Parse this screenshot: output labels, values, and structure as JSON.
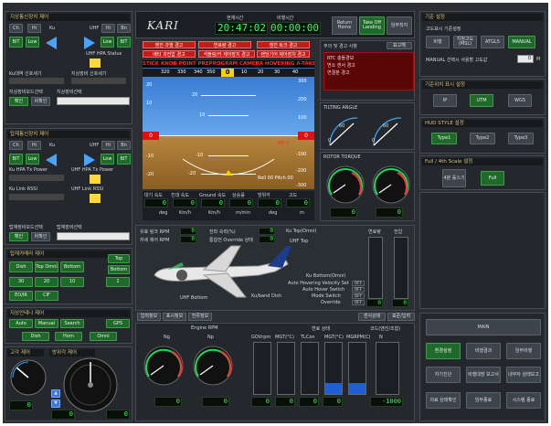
{
  "left": {
    "sec1": {
      "title": "지상통신장치 제어",
      "row1": [
        "Ch",
        "Hi",
        "Ku",
        "UHF",
        "Hi",
        "Bn"
      ],
      "row2a": "BIT",
      "row2b": "Low",
      "row2c": "Low",
      "row2d": "BIT",
      "status": "UHF HPA Status",
      "lbl1": "Ku대역 신호세기",
      "lbl2": "지상장비 신호세기",
      "lbl3": "지상장비모드선택",
      "lbl4": "지상장비선택",
      "btn_a": "확인",
      "btn_b": "비확인"
    },
    "sec2": {
      "title": "탑재통신장치 제어",
      "row1": [
        "Ch",
        "Hi",
        "Ku",
        "UHF",
        "Hi",
        "Bn"
      ],
      "row2a": "BIT",
      "row2b": "Low",
      "row2c": "Low",
      "row2d": "BIT",
      "l1": "Ku HPA Tx Power",
      "l2": "UHF HPA Tx Power",
      "l3": "Ku Link RSSI",
      "l4": "UHF Link RSSI",
      "l5": "탑재장비모드선택",
      "l6": "탑재장비선택",
      "btn_a": "확인",
      "btn_b": "비확인"
    },
    "sec3": {
      "title": "탑재카메라 제어",
      "b1": "Dish",
      "b2": "Top Omni",
      "b3": "Bottom",
      "b4": "Top",
      "b5": "Bottom",
      "n1": "30",
      "n2": "20",
      "n3": "10",
      "n4": "1",
      "b6": "EO/IR",
      "b7": "CIF"
    },
    "sec4": {
      "title": "지상안테나 제어",
      "b1": "Auto",
      "b2": "Manual",
      "b3": "Search",
      "b4": "GPS",
      "b5": "Dish",
      "b6": "Horn",
      "b7": "Omni"
    },
    "sec5": {
      "title1": "고각 제어",
      "title2": "방위각 제어",
      "seg1": "0",
      "seg2": "0",
      "seg3": "0"
    }
  },
  "center": {
    "logo": "KARI",
    "time_lbl1": "현재시간",
    "time_lbl2": "비행시간",
    "clock": "20:47:02",
    "flight": "00:00:00",
    "btn_return": "Return Home",
    "btn_takeoff": "Take Off Landing",
    "btn_mission": "임무착지",
    "warn": [
      "엔진 과열 경고",
      "연료량 경고",
      "엔진 토크 경고",
      "배터 과전압 경고",
      "석블링/카 제어장치 경고",
      "랜딩기어 제어장치 경고"
    ],
    "mode_bar": "STICK KNOB POINT PREPROGRAM CAMERA HOVERING A-TAKEOFF",
    "heading_ticks": [
      "320",
      "330",
      "340",
      "350",
      "0",
      "10",
      "20",
      "30",
      "40"
    ],
    "alarm_title": "주의 및 경고 사항",
    "alarm_btn": "표고해",
    "alarms": [
      "RTC 충돌경보",
      "연소 센서 경고",
      "연결분 경고"
    ],
    "pfd_left": [
      "20",
      "10",
      "0",
      "-10",
      "-20"
    ],
    "pfd_right": [
      "300",
      "200",
      "100",
      "0",
      "-100",
      "-200",
      "-300"
    ],
    "pitch": [
      "20",
      "10",
      "-10",
      "-20"
    ],
    "pfd_bottom": "Roll 00  Pitch 00",
    "mp_label": "MP 0",
    "readout_lbls": [
      "대기 속도",
      "진대 속도",
      "Ground 속도",
      "상승률",
      "방위각",
      "고도"
    ],
    "readout_units": [
      "deg",
      "Km/h",
      "Km/h",
      "m/min",
      "deg",
      "m"
    ],
    "readout_vals": [
      "0",
      "0",
      "0",
      "0",
      "0",
      "0"
    ],
    "tilting_title": "TILTING ANGLE",
    "torque_title": "ROTOR TORQUE",
    "tilting_ticks": [
      "0",
      "30",
      "60",
      "90"
    ],
    "torque_ticks": [
      "0",
      "20",
      "40",
      "60",
      "80",
      "100"
    ]
  },
  "aircraft": {
    "lbls": [
      "유효 링크 RPM",
      "자세 제어 RPM",
      "전파 속력(%)",
      "통합전 Override 상태"
    ],
    "ku_top": "Ku Top(Omni)",
    "uhf_top": "UHF Top",
    "ku_bottom": "Ku Bottom(Omni)",
    "ku_dish": "Ku/band Dish",
    "uhf_bottom": "UHF Bottom",
    "switches": [
      "Auto Hovering Velocity Set",
      "Auto Hover Switch",
      "Mode Switch",
      "Override"
    ],
    "sw_vals": [
      "OFF",
      "OFF",
      "OFF",
      "OFF"
    ],
    "right_lbls": [
      "연료량",
      "전압"
    ],
    "tabs": [
      "입력정보",
      "표시정보",
      "전류정보"
    ],
    "tabs_r": [
      "센서상태",
      "표준/입력"
    ]
  },
  "engine": {
    "title": "Engine RPM",
    "ng": "Ng",
    "np": "Np",
    "ng_val": "0",
    "np_val": "0",
    "hdrs": [
      "연료 상태",
      "코드(엔진/조합)"
    ],
    "cols": [
      "GOVrpm",
      "MGT(°C)",
      "TLCon",
      "MGT(°C)",
      "MGRPM(C)",
      "N"
    ],
    "seg": [
      "0",
      "0",
      "0",
      "0",
      "-1000"
    ]
  },
  "right": {
    "sec1": {
      "title": "기준 설정",
      "sub": "고도표시 기준설정",
      "b1": "비행",
      "b2": "지정고도(MSL)",
      "b3": "ATGL5",
      "b4": "MANUAL",
      "mrow": "MANUAL 선택시 사용할 고도값",
      "mval": "0",
      "munit": "M"
    },
    "sec2": {
      "title": "기준위치 표시 설정",
      "b1": "IP",
      "b2": "UTM",
      "b3": "WGS"
    },
    "sec3": {
      "title": "HUD STYLE 설정",
      "b1": "Type1",
      "b2": "Type2",
      "b3": "Type3"
    },
    "sec4": {
      "title": "Full / 4th Scale 설정",
      "b1": "4분 홀스기",
      "b2": "Full"
    },
    "bottom": {
      "main": "MAIN",
      "b": [
        "환경설정",
        "비행결과",
        "임무비행",
        "자기진단",
        "비행대장 보고서",
        "내부자 상태보고",
        "의료 상태확인",
        "임무종료",
        "시스템 종료"
      ]
    }
  }
}
